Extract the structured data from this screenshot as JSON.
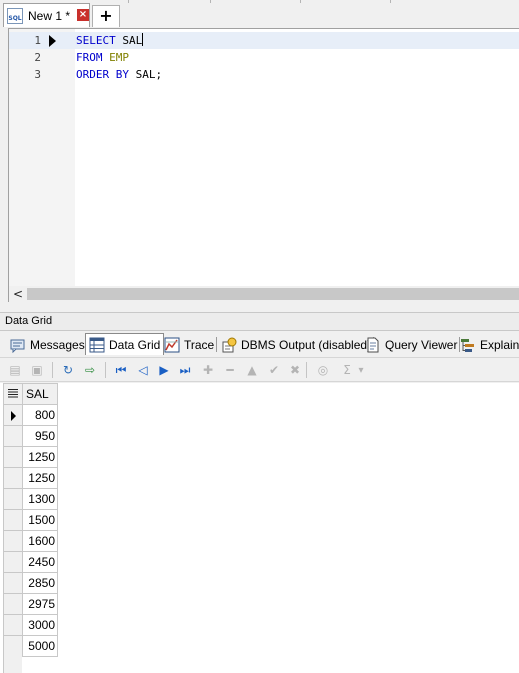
{
  "document_tabs": [
    {
      "label": "New 1 *",
      "icon": "sql-file-icon",
      "active": true
    }
  ],
  "new_tab_label": "+",
  "editor": {
    "lines": [
      {
        "number": "1",
        "tokens": [
          {
            "text": "SELECT",
            "kind": "kw"
          },
          {
            "text": " SAL",
            "kind": "plain"
          }
        ]
      },
      {
        "number": "2",
        "tokens": [
          {
            "text": "FROM",
            "kind": "kw"
          },
          {
            "text": " ",
            "kind": "plain"
          },
          {
            "text": "EMP",
            "kind": "tbl"
          }
        ]
      },
      {
        "number": "3",
        "tokens": [
          {
            "text": "ORDER BY",
            "kind": "kw"
          },
          {
            "text": " SAL;",
            "kind": "plain"
          }
        ]
      }
    ],
    "current_line": 1,
    "scroll_left_arrow": "<"
  },
  "colors": {
    "keyword": "#0000cc",
    "table": "#808000",
    "close_button": "#c9302c",
    "nav_button": "#1a5fc4"
  },
  "panel": {
    "title": "Data Grid"
  },
  "result_tabs": [
    {
      "label": "Messages",
      "icon": "messages-icon",
      "active": false
    },
    {
      "label": "Data Grid",
      "icon": "data-grid-icon",
      "active": true
    },
    {
      "label": "Trace",
      "icon": "trace-icon",
      "active": false
    },
    {
      "label": "DBMS Output (disabled)",
      "icon": "dbms-output-icon",
      "active": false
    },
    {
      "label": "Query Viewer",
      "icon": "query-viewer-icon",
      "active": false
    },
    {
      "label": "Explain",
      "icon": "explain-icon",
      "active": false
    }
  ],
  "toolbar": {
    "buttons": [
      {
        "name": "save-icon",
        "glyph": "▤",
        "enabled": false
      },
      {
        "name": "print-icon",
        "glyph": "▣",
        "enabled": false
      },
      {
        "name": "refresh-grid-icon",
        "glyph": "↻",
        "enabled": true
      },
      {
        "name": "export-icon",
        "glyph": "⇨",
        "enabled": true
      },
      {
        "name": "first-record-icon",
        "glyph": "⏮",
        "enabled": true
      },
      {
        "name": "prior-record-icon",
        "glyph": "◁",
        "enabled": true
      },
      {
        "name": "next-record-icon",
        "glyph": "▶",
        "enabled": true
      },
      {
        "name": "last-record-icon",
        "glyph": "⏭",
        "enabled": true
      },
      {
        "name": "insert-record-icon",
        "glyph": "✚",
        "enabled": false
      },
      {
        "name": "delete-record-icon",
        "glyph": "━",
        "enabled": false
      },
      {
        "name": "edit-record-icon",
        "glyph": "▲",
        "enabled": false
      },
      {
        "name": "post-edit-icon",
        "glyph": "✔",
        "enabled": false
      },
      {
        "name": "cancel-edit-icon",
        "glyph": "✖",
        "enabled": false
      },
      {
        "name": "filter-icon",
        "glyph": "◎",
        "enabled": false
      },
      {
        "name": "sum-icon",
        "glyph": "Σ",
        "enabled": false
      },
      {
        "name": "sum-dropdown-icon",
        "glyph": "▾",
        "enabled": false
      }
    ]
  },
  "grid": {
    "columns": [
      "SAL"
    ],
    "rows": [
      "800",
      "950",
      "1250",
      "1250",
      "1300",
      "1500",
      "1600",
      "2450",
      "2850",
      "2975",
      "3000",
      "5000"
    ],
    "current_row": 0
  }
}
